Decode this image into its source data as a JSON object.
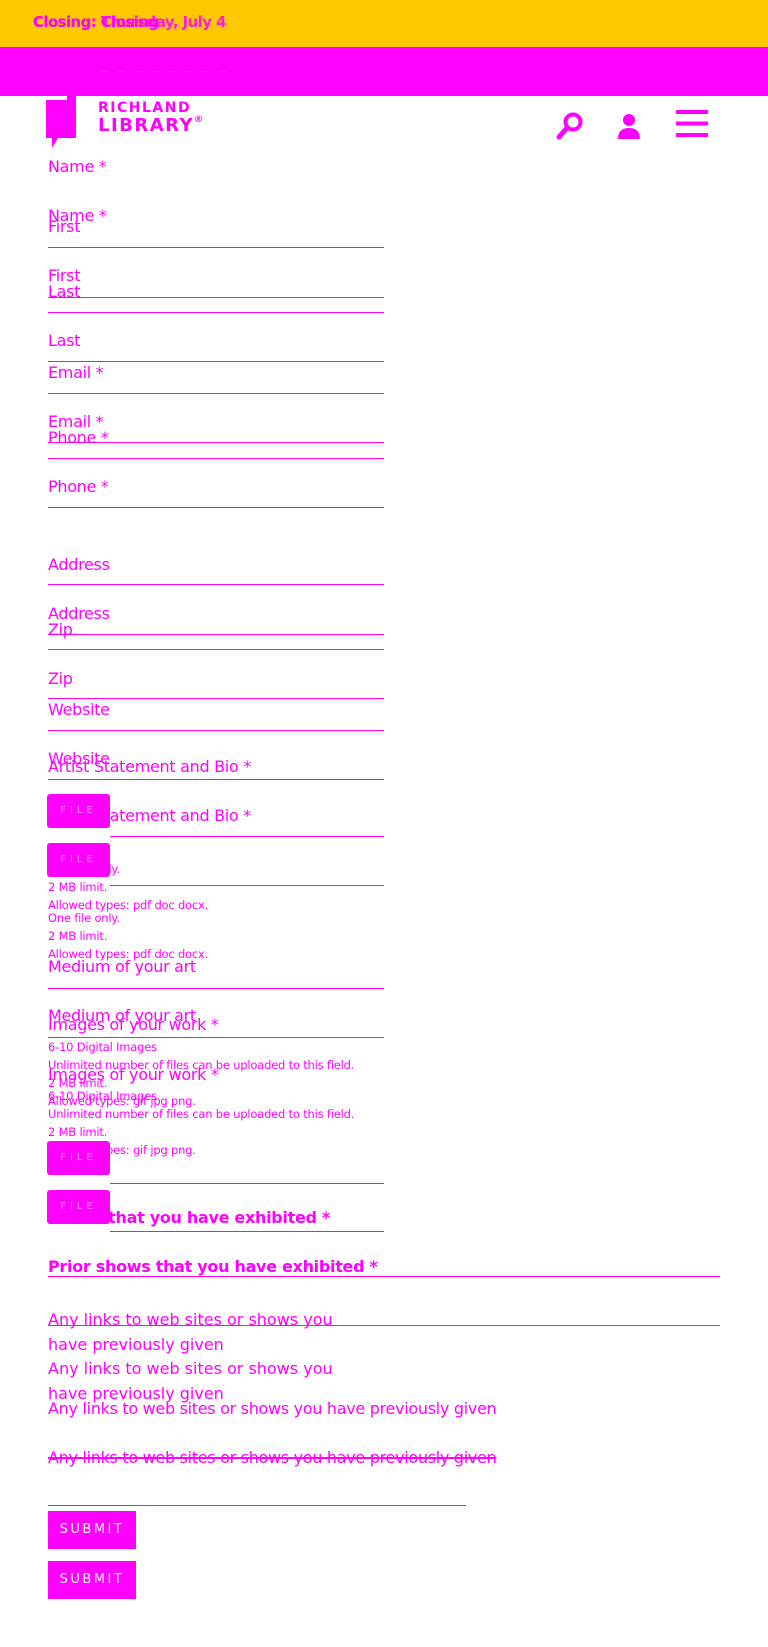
{
  "alert": {
    "line_a": "Closing: Closing",
    "line_b": "Closing: Thursday, July 4"
  },
  "nav_strip": {
    "text": "— — — — — — — —"
  },
  "logo": {
    "line1": "RICHLAND",
    "line2": "LIBRARY",
    "mark": "®"
  },
  "header": {
    "icons": [
      "search-icon",
      "account-icon",
      "menu-icon"
    ]
  },
  "colors": {
    "primary": "#ff00ff",
    "alert_bg": "#ffc800",
    "bg": "#ffffff"
  },
  "form": {
    "name_label": "Name *",
    "first_label": "First",
    "last_label": "Last",
    "email_label": "Email *",
    "phone_label": "Phone *",
    "address_label": "Address",
    "zip_label": "Zip",
    "website_label": "Website",
    "artist_label": "Artist Statement and Bio *",
    "file_button": "FILE",
    "one_file": "One file only.",
    "size_limit": "2 MB limit.",
    "allowed_docs": "Allowed types: pdf doc docx.",
    "medium_label": "Medium of your art",
    "images_label": "Images of your work *",
    "images_hint": "6-10 Digital Images",
    "unlimited": "Unlimited number of files can be uploaded to this field.",
    "allowed_images": "Allowed types: gif jpg png.",
    "prior_label": "Prior shows that you have exhibited *",
    "links_label": "Any links to web sites or shows you have previously given",
    "submit": "SUBMIT"
  }
}
